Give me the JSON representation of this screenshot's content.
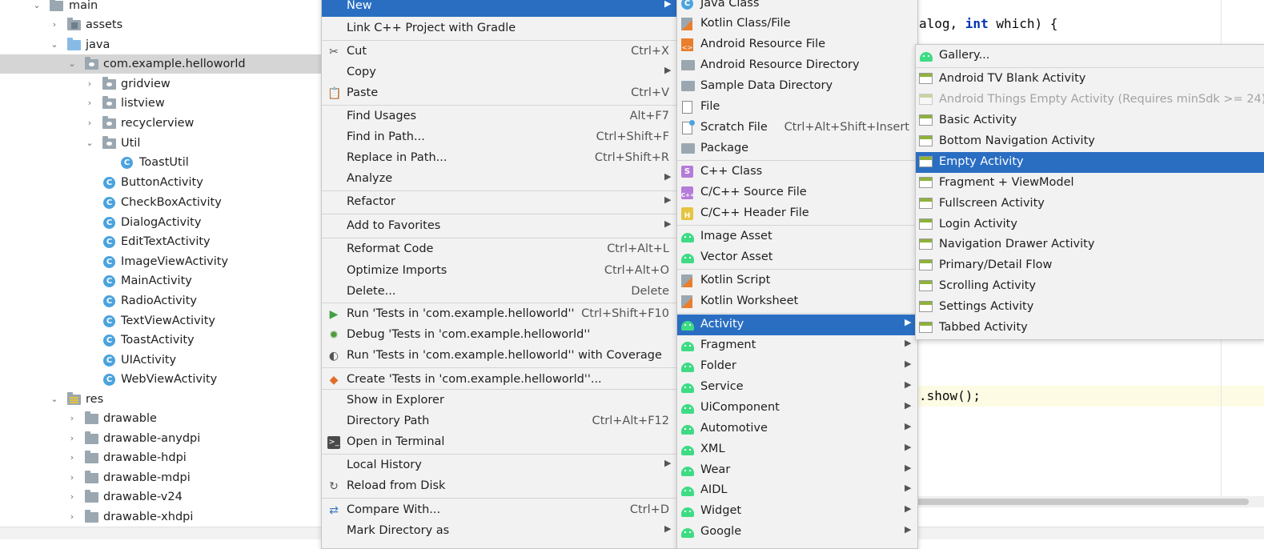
{
  "tree": {
    "rows": [
      {
        "label": "main",
        "icon": "folder-icon"
      },
      {
        "label": "assets",
        "icon": "assets-folder-icon"
      },
      {
        "label": "java",
        "icon": "source-folder-icon"
      },
      {
        "label": "com.example.helloworld",
        "icon": "package-icon"
      },
      {
        "label": "gridview",
        "icon": "package-icon"
      },
      {
        "label": "listview",
        "icon": "package-icon"
      },
      {
        "label": "recyclerview",
        "icon": "package-icon"
      },
      {
        "label": "Util",
        "icon": "package-icon"
      },
      {
        "label": "ToastUtil",
        "icon": "class-icon"
      },
      {
        "label": "ButtonActivity",
        "icon": "class-icon"
      },
      {
        "label": "CheckBoxActivity",
        "icon": "class-icon"
      },
      {
        "label": "DialogActivity",
        "icon": "class-icon"
      },
      {
        "label": "EditTextActivity",
        "icon": "class-icon"
      },
      {
        "label": "ImageViewActivity",
        "icon": "class-icon"
      },
      {
        "label": "MainActivity",
        "icon": "class-icon"
      },
      {
        "label": "RadioActivity",
        "icon": "class-icon"
      },
      {
        "label": "TextViewActivity",
        "icon": "class-icon"
      },
      {
        "label": "ToastActivity",
        "icon": "class-icon"
      },
      {
        "label": "UIActivity",
        "icon": "class-icon"
      },
      {
        "label": "WebViewActivity",
        "icon": "class-icon"
      },
      {
        "label": "res",
        "icon": "resources-folder-icon"
      },
      {
        "label": "drawable",
        "icon": "folder-icon"
      },
      {
        "label": "drawable-anydpi",
        "icon": "folder-icon"
      },
      {
        "label": "drawable-hdpi",
        "icon": "folder-icon"
      },
      {
        "label": "drawable-mdpi",
        "icon": "folder-icon"
      },
      {
        "label": "drawable-v24",
        "icon": "folder-icon"
      },
      {
        "label": "drawable-xhdpi",
        "icon": "folder-icon"
      }
    ],
    "selected": "com.example.helloworld"
  },
  "editor": {
    "line1_pre": "alog, ",
    "line1_kw": "int",
    "line1_post": " which) {",
    "line2": ".show();"
  },
  "context_menu": {
    "items": [
      {
        "label": "New",
        "submenu": true,
        "highlighted": true
      },
      {
        "label": "Link C++ Project with Gradle"
      },
      {
        "label": "Cut",
        "shortcut": "Ctrl+X",
        "icon": "scissors-icon"
      },
      {
        "label": "Copy",
        "submenu": true
      },
      {
        "label": "Paste",
        "shortcut": "Ctrl+V",
        "icon": "clipboard-icon"
      },
      {
        "label": "Find Usages",
        "shortcut": "Alt+F7"
      },
      {
        "label": "Find in Path...",
        "shortcut": "Ctrl+Shift+F"
      },
      {
        "label": "Replace in Path...",
        "shortcut": "Ctrl+Shift+R"
      },
      {
        "label": "Analyze",
        "submenu": true
      },
      {
        "label": "Refactor",
        "submenu": true
      },
      {
        "label": "Add to Favorites",
        "submenu": true
      },
      {
        "label": "Reformat Code",
        "shortcut": "Ctrl+Alt+L"
      },
      {
        "label": "Optimize Imports",
        "shortcut": "Ctrl+Alt+O"
      },
      {
        "label": "Delete...",
        "shortcut": "Delete"
      },
      {
        "label": "Run 'Tests in 'com.example.helloworld''",
        "shortcut": "Ctrl+Shift+F10",
        "icon": "run-icon"
      },
      {
        "label": "Debug 'Tests in 'com.example.helloworld''",
        "icon": "debug-icon"
      },
      {
        "label": "Run 'Tests in 'com.example.helloworld'' with Coverage",
        "icon": "coverage-icon"
      },
      {
        "label": "Create 'Tests in 'com.example.helloworld''...",
        "icon": "create-test-icon"
      },
      {
        "label": "Show in Explorer"
      },
      {
        "label": "Directory Path",
        "shortcut": "Ctrl+Alt+F12"
      },
      {
        "label": "Open in Terminal",
        "icon": "terminal-icon"
      },
      {
        "label": "Local History",
        "submenu": true
      },
      {
        "label": "Reload from Disk",
        "icon": "reload-icon"
      },
      {
        "label": "Compare With...",
        "shortcut": "Ctrl+D",
        "icon": "compare-icon"
      },
      {
        "label": "Mark Directory as",
        "submenu": true
      }
    ]
  },
  "new_menu": {
    "items": [
      {
        "label": "Java Class",
        "icon": "java-class-icon"
      },
      {
        "label": "Kotlin Class/File",
        "icon": "kotlin-file-icon"
      },
      {
        "label": "Android Resource File",
        "icon": "android-resource-file-icon"
      },
      {
        "label": "Android Resource Directory",
        "icon": "folder-icon"
      },
      {
        "label": "Sample Data Directory",
        "icon": "folder-icon"
      },
      {
        "label": "File",
        "icon": "file-icon"
      },
      {
        "label": "Scratch File",
        "shortcut": "Ctrl+Alt+Shift+Insert",
        "icon": "scratch-file-icon"
      },
      {
        "label": "Package",
        "icon": "package-icon"
      },
      {
        "label": "C++ Class",
        "icon": "cpp-class-icon"
      },
      {
        "label": "C/C++ Source File",
        "icon": "cpp-source-icon"
      },
      {
        "label": "C/C++ Header File",
        "icon": "cpp-header-icon"
      },
      {
        "label": "Image Asset",
        "icon": "android-icon"
      },
      {
        "label": "Vector Asset",
        "icon": "android-icon"
      },
      {
        "label": "Kotlin Script",
        "icon": "kotlin-script-icon"
      },
      {
        "label": "Kotlin Worksheet",
        "icon": "kotlin-worksheet-icon"
      },
      {
        "label": "Activity",
        "submenu": true,
        "highlighted": true,
        "icon": "android-icon"
      },
      {
        "label": "Fragment",
        "submenu": true,
        "icon": "android-icon"
      },
      {
        "label": "Folder",
        "submenu": true,
        "icon": "android-icon"
      },
      {
        "label": "Service",
        "submenu": true,
        "icon": "android-icon"
      },
      {
        "label": "UiComponent",
        "submenu": true,
        "icon": "android-icon"
      },
      {
        "label": "Automotive",
        "submenu": true,
        "icon": "android-icon"
      },
      {
        "label": "XML",
        "submenu": true,
        "icon": "android-icon"
      },
      {
        "label": "Wear",
        "submenu": true,
        "icon": "android-icon"
      },
      {
        "label": "AIDL",
        "submenu": true,
        "icon": "android-icon"
      },
      {
        "label": "Widget",
        "submenu": true,
        "icon": "android-icon"
      },
      {
        "label": "Google",
        "submenu": true,
        "icon": "android-icon"
      }
    ]
  },
  "activity_menu": {
    "items": [
      {
        "label": "Gallery...",
        "icon": "android-icon"
      },
      {
        "label": "Android TV Blank Activity",
        "icon": "activity-template-icon"
      },
      {
        "label": "Android Things Empty Activity (Requires minSdk >= 24)",
        "icon": "activity-template-icon",
        "disabled": true
      },
      {
        "label": "Basic Activity",
        "icon": "activity-template-icon"
      },
      {
        "label": "Bottom Navigation Activity",
        "icon": "activity-template-icon"
      },
      {
        "label": "Empty Activity",
        "icon": "activity-template-icon",
        "highlighted": true
      },
      {
        "label": "Fragment + ViewModel",
        "icon": "activity-template-icon"
      },
      {
        "label": "Fullscreen Activity",
        "icon": "activity-template-icon"
      },
      {
        "label": "Login Activity",
        "icon": "activity-template-icon"
      },
      {
        "label": "Navigation Drawer Activity",
        "icon": "activity-template-icon"
      },
      {
        "label": "Primary/Detail Flow",
        "icon": "activity-template-icon"
      },
      {
        "label": "Scrolling Activity",
        "icon": "activity-template-icon"
      },
      {
        "label": "Settings Activity",
        "icon": "activity-template-icon"
      },
      {
        "label": "Tabbed Activity",
        "icon": "activity-template-icon"
      }
    ]
  },
  "colors": {
    "highlight": "#2a6ec2",
    "menu_bg": "#f2f2f2",
    "tree_selection": "#d5d5d5",
    "android_green": "#3ddc84"
  }
}
